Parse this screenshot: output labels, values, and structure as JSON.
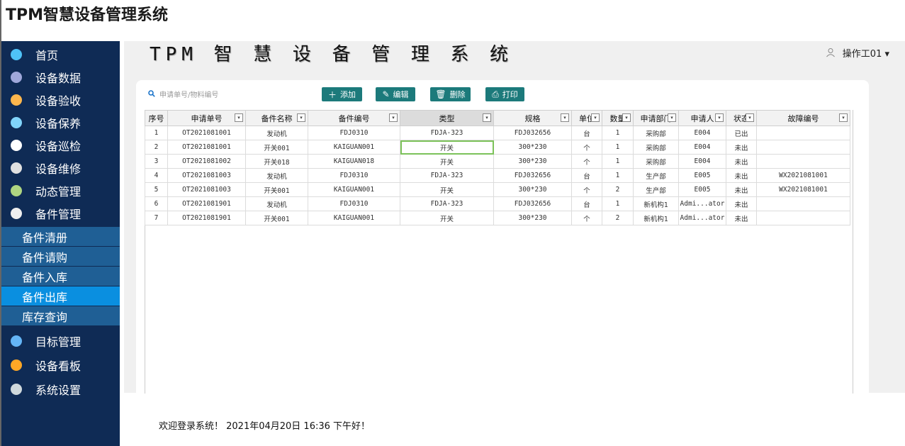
{
  "window": {
    "title": "TPM智慧设备管理系统"
  },
  "header": {
    "app_title": "TPM 智 慧 设 备 管 理 系 统",
    "user": "操作工01 ▾"
  },
  "sidebar": {
    "items": [
      {
        "label": "首页",
        "icon": "home-icon",
        "color": "#4fc3f7"
      },
      {
        "label": "设备数据",
        "icon": "monitor-icon",
        "color": "#9fa8da"
      },
      {
        "label": "设备验收",
        "icon": "checklist-icon",
        "color": "#ffb74d"
      },
      {
        "label": "设备保养",
        "icon": "maintenance-icon",
        "color": "#81d4fa"
      },
      {
        "label": "设备巡检",
        "icon": "inspection-icon",
        "color": "#ffffff"
      },
      {
        "label": "设备维修",
        "icon": "tools-icon",
        "color": "#e0e0e0"
      },
      {
        "label": "动态管理",
        "icon": "share-icon",
        "color": "#aed581"
      },
      {
        "label": "备件管理",
        "icon": "calendar-icon",
        "color": "#eeeeee"
      }
    ],
    "sub_items": [
      {
        "label": "备件清册"
      },
      {
        "label": "备件请购"
      },
      {
        "label": "备件入库"
      },
      {
        "label": "备件出库",
        "active": true
      },
      {
        "label": "库存查询"
      }
    ],
    "items_bottom": [
      {
        "label": "目标管理",
        "icon": "target-icon",
        "color": "#64b5f6"
      },
      {
        "label": "设备看板",
        "icon": "dashboard-icon",
        "color": "#ffa726"
      },
      {
        "label": "系统设置",
        "icon": "gear-icon",
        "color": "#cfd8dc"
      }
    ]
  },
  "toolbar": {
    "search_placeholder": "申请单号/物料编号",
    "add": "添加",
    "edit": "编辑",
    "delete": "删除",
    "print": "打印"
  },
  "table": {
    "columns": [
      "序号",
      "申请单号",
      "备件名称",
      "备件编号",
      "类型",
      "规格",
      "单位",
      "数量",
      "申请部门",
      "申请人",
      "状态",
      "故障编号"
    ],
    "rows": [
      [
        "1",
        "OT2021081001",
        "发动机",
        "FDJ0310",
        "FDJA-323",
        "FDJ032656",
        "台",
        "1",
        "采购部",
        "E004",
        "已出",
        ""
      ],
      [
        "2",
        "OT2021081001",
        "开关001",
        "KAIGUAN001",
        "开关",
        "300*230",
        "个",
        "1",
        "采购部",
        "E004",
        "未出",
        ""
      ],
      [
        "3",
        "OT2021081002",
        "开关018",
        "KAIGUAN018",
        "开关",
        "300*230",
        "个",
        "1",
        "采购部",
        "E004",
        "未出",
        ""
      ],
      [
        "4",
        "OT2021081003",
        "发动机",
        "FDJ0310",
        "FDJA-323",
        "FDJ032656",
        "台",
        "1",
        "生产部",
        "E005",
        "未出",
        "WX2021081001"
      ],
      [
        "5",
        "OT2021081003",
        "开关001",
        "KAIGUAN001",
        "开关",
        "300*230",
        "个",
        "2",
        "生产部",
        "E005",
        "未出",
        "WX2021081001"
      ],
      [
        "6",
        "OT2021081901",
        "发动机",
        "FDJ0310",
        "FDJA-323",
        "FDJ032656",
        "台",
        "1",
        "新机构1",
        "Admi...ator",
        "未出",
        ""
      ],
      [
        "7",
        "OT2021081901",
        "开关001",
        "KAIGUAN001",
        "开关",
        "300*230",
        "个",
        "2",
        "新机构1",
        "Admi...ator",
        "未出",
        ""
      ]
    ]
  },
  "footer": {
    "text": "欢迎登录系统！ 2021年04月20日 16:36 下午好！"
  }
}
